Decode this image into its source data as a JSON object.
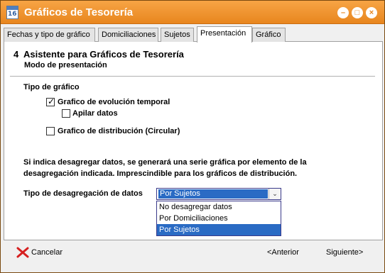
{
  "window": {
    "title": "Gráficos de Tesorería",
    "icon_number": "16",
    "icon": "calendar-icon"
  },
  "title_buttons": {
    "minimize": "minimize-icon",
    "maximize": "maximize-icon",
    "close": "close-icon"
  },
  "tabs": [
    {
      "label": "Fechas y tipo de gráfico",
      "active": false
    },
    {
      "label": "Domiciliaciones",
      "active": false
    },
    {
      "label": "Sujetos",
      "active": false
    },
    {
      "label": "Presentación",
      "active": true
    },
    {
      "label": "Gráfico",
      "active": false
    }
  ],
  "wizard": {
    "step": "4",
    "title": "Asistente para Gráficos de Tesorería",
    "subtitle": "Modo de presentación"
  },
  "chart_type": {
    "heading": "Tipo de gráfico",
    "evolution": {
      "label": "Grafico de evolución temporal",
      "checked": true
    },
    "stack": {
      "label": "Apilar datos",
      "checked": false
    },
    "distribution": {
      "label": "Grafico de distribución (Circular)",
      "checked": false
    }
  },
  "note": "Si indica desagregar datos, se generará una serie gráfica por elemento de la desagregación indicada. Imprescindible para los gráficos de distribución.",
  "breakdown": {
    "label": "Tipo de desagregación de datos",
    "selected": "Por Sujetos",
    "options": [
      "No desagregar datos",
      "Por Domiciliaciones",
      "Por Sujetos"
    ]
  },
  "footer": {
    "cancel": "Cancelar",
    "previous": "<Anterior",
    "next": "Siguiente>"
  },
  "colors": {
    "titlebar": "#e8861e",
    "selection": "#2a6bc4",
    "cancel_icon": "#d62020"
  }
}
